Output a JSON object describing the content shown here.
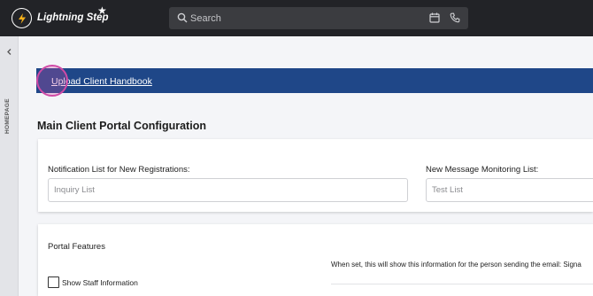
{
  "app": {
    "title": "Lightning Step"
  },
  "search": {
    "placeholder": "Search"
  },
  "sidebar": {
    "label": "HOMEPAGE"
  },
  "banner": {
    "link_label": "Upload Client Handbook"
  },
  "main": {
    "title": "Main Client Portal Configuration",
    "notification": {
      "label": "Notification List for New Registrations:",
      "placeholder": "Inquiry List"
    },
    "monitoring": {
      "label": "New Message Monitoring List:",
      "placeholder": "Test List"
    },
    "portal_features": {
      "title": "Portal Features",
      "description": "When set, this will show this information for the person sending the email: Signa",
      "show_staff": {
        "label": "Show Staff Information",
        "checked": false
      }
    }
  },
  "colors": {
    "topbar": "#222327",
    "banner": "#1f4788",
    "highlight": "#d04aa6"
  }
}
